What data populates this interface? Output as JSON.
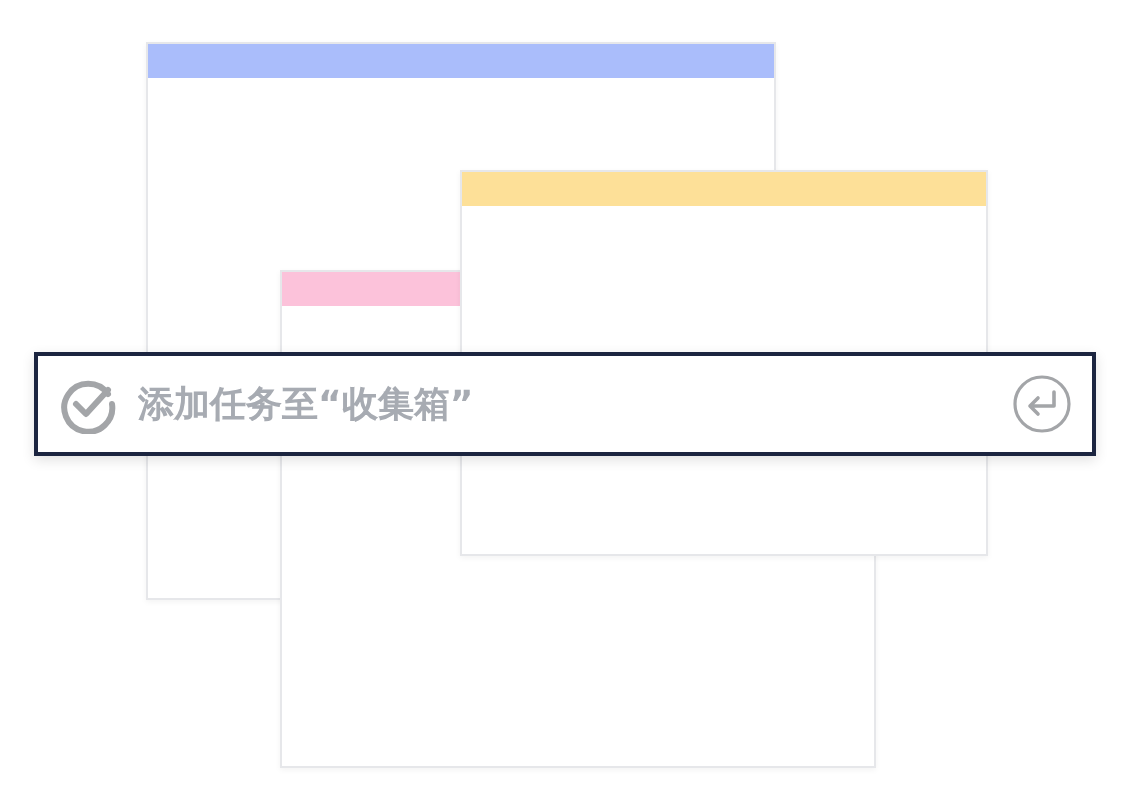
{
  "cards": [
    {
      "color": "#aabdfb"
    },
    {
      "color": "#fcc2da"
    },
    {
      "color": "#fde098"
    }
  ],
  "quick_add": {
    "placeholder": "添加任务至“收集箱”"
  }
}
